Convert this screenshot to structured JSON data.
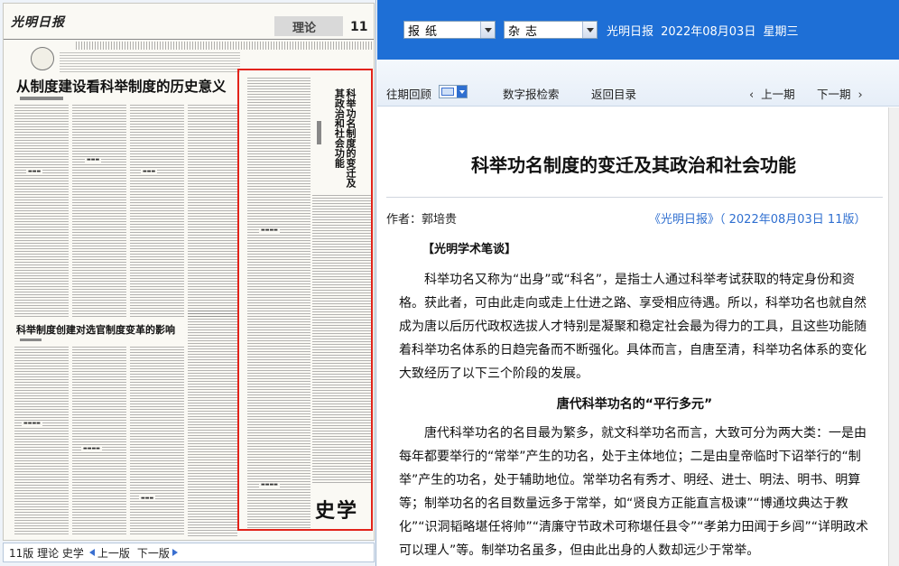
{
  "newspaper": {
    "masthead": "光明日报",
    "section": "理论",
    "page_number": "11",
    "headline_main": "从制度建设看科举制度的历史意义",
    "headline_secondary": "科举制度创建对选官制度变革的影响",
    "highlighted_title": "科举功名制度的变迁及其政治和社会功能",
    "column_logo": "史学"
  },
  "page_status": {
    "label": "11版 理论 史学",
    "prev": "上一版",
    "next": "下一版"
  },
  "toolbar": {
    "select_newspaper": "报纸",
    "select_magazine": "杂志",
    "paper_name": "光明日报",
    "date": "2022年08月03日",
    "weekday": "星期三"
  },
  "nav": {
    "archive": "往期回顾",
    "search": "数字报检索",
    "back": "返回目录",
    "prev_issue": "上一期",
    "next_issue": "下一期"
  },
  "article": {
    "title": "科举功名制度的变迁及其政治和社会功能",
    "author": "作者：郭培贵",
    "source": "《光明日报》（ 2022年08月03日   11版）",
    "column": "【光明学术笔谈】",
    "paragraph_1": "科举功名又称为“出身”或“科名”，是指士人通过科举考试获取的特定身份和资格。获此者，可由此走向或走上仕进之路、享受相应待遇。所以，科举功名也就自然成为唐以后历代政权选拔人才特别是凝聚和稳定社会最为得力的工具，且这些功能随着科举功名体系的日趋完备而不断强化。具体而言，自唐至清，科举功名体系的变化大致经历了以下三个阶段的发展。",
    "subtitle_1": "唐代科举功名的“平行多元”",
    "paragraph_2": "唐代科举功名的名目最为繁多，就文科举功名而言，大致可分为两大类：一是由每年都要举行的“常举”产生的功名，处于主体地位；二是由皇帝临时下诏举行的“制举”产生的功名，处于辅助地位。常举功名有秀才、明经、进士、明法、明书、明算等；制举功名的名目数量远多于常举，如“贤良方正能直言极谏”“博通坟典达于教化”“识洞韬略堪任将帅”“清廉守节政术可称堪任县令”“孝弟力田闻于乡闾”“详明政术可以理人”等。制举功名虽多，但由此出身的人数却远少于常举。"
  }
}
